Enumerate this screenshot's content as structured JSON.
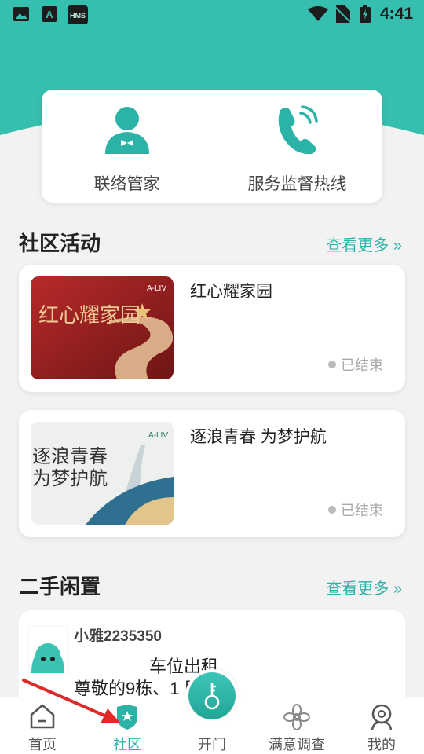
{
  "colors": {
    "brand": "#2bb3a8",
    "status_bar": "#36bfae",
    "inactive": "#555555"
  },
  "status_bar": {
    "time": "4:41",
    "left_icons": [
      "image-icon",
      "a-app-icon",
      "hms-icon"
    ],
    "right_icons": [
      "wifi-icon",
      "no-sim-icon",
      "battery-icon"
    ],
    "hms_label": "HMS",
    "a_label": "A"
  },
  "quick_actions": [
    {
      "label": "联络管家",
      "icon": "butler-icon"
    },
    {
      "label": "服务监督热线",
      "icon": "phone-icon"
    }
  ],
  "community": {
    "title": "社区活动",
    "more": "查看更多 »",
    "activities": [
      {
        "title": "红心耀家园",
        "status": "已结束",
        "image_text": "红心耀家园",
        "brand": "A-LIV"
      },
      {
        "title": "逐浪青春 为梦护航",
        "status": "已结束",
        "image_text_line1": "逐浪青春",
        "image_text_line2": "为梦护航",
        "brand": "A-LIV"
      }
    ]
  },
  "secondhand": {
    "title": "二手闲置",
    "more": "查看更多 »",
    "post": {
      "user": "小雅2235350",
      "title": "车位出租",
      "body": "尊敬的9栋、1  民:"
    }
  },
  "tabbar": {
    "items": [
      {
        "label": "首页",
        "icon": "home-icon"
      },
      {
        "label": "社区",
        "icon": "community-shield-icon"
      },
      {
        "label": "开门",
        "icon": "key-icon"
      },
      {
        "label": "满意调查",
        "icon": "flower-icon"
      },
      {
        "label": "我的",
        "icon": "profile-icon"
      }
    ]
  }
}
